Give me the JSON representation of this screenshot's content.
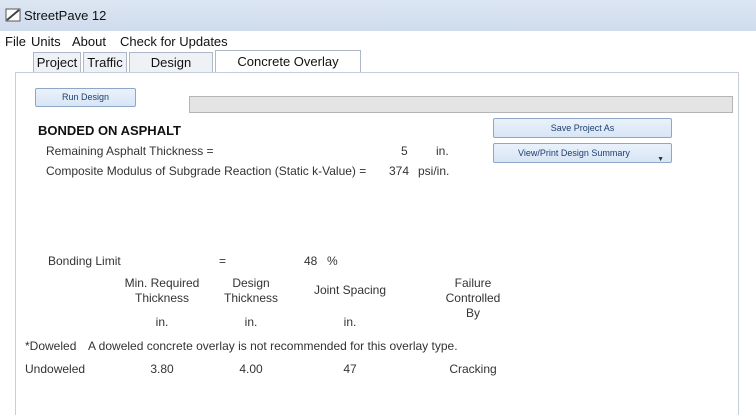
{
  "window": {
    "title": "StreetPave 12"
  },
  "menu": [
    "File",
    "Units",
    "About",
    "Check for Updates"
  ],
  "tabs": [
    "Project",
    "Traffic",
    "Design Details",
    "Concrete Overlay Design"
  ],
  "active_tab": 3,
  "buttons": {
    "run_design": "Run Design",
    "save_project_as": "Save Project As",
    "view_print_summary": "View/Print Design Summary"
  },
  "progress": {
    "value": 0
  },
  "design": {
    "heading": "BONDED ON ASPHALT",
    "remaining_label": "Remaining Asphalt Thickness =",
    "remaining_value": "5",
    "remaining_unit": "in.",
    "composite_label": "Composite Modulus of Subgrade Reaction (Static k-Value)  =",
    "composite_value": "374",
    "composite_unit": "psi/in.",
    "bonding_label": "Bonding Limit",
    "bonding_eq": "=",
    "bonding_value": "48",
    "bonding_unit": "%"
  },
  "table": {
    "headers": {
      "min_required": [
        "Min. Required",
        "Thickness"
      ],
      "design": [
        "Design",
        "Thickness"
      ],
      "joint_spacing": "Joint Spacing",
      "failure": [
        "Failure",
        "Controlled",
        "By"
      ]
    },
    "units": {
      "min_required": "in.",
      "design": "in.",
      "joint_spacing": "in."
    },
    "doweled": {
      "label": "*Doweled",
      "message": "A doweled concrete overlay is not recommended for this overlay type."
    },
    "undoweled": {
      "label": "Undoweled",
      "min_required": "3.80",
      "design": "4.00",
      "joint_spacing": "47",
      "failure": "Cracking"
    }
  }
}
